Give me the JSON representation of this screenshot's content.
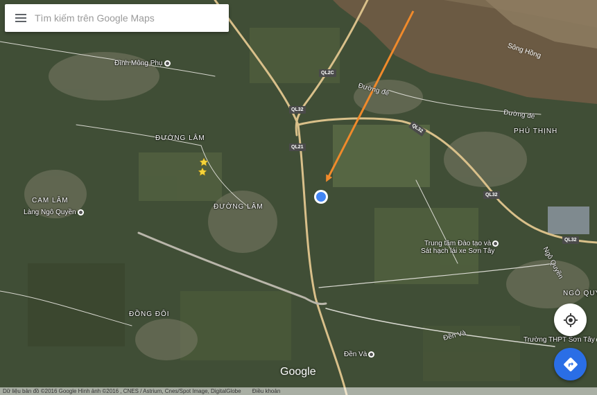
{
  "search": {
    "placeholder": "Tìm kiếm trên Google Maps"
  },
  "icons": {
    "menu": "menu-icon",
    "my_location": "my-location-icon",
    "directions": "directions-icon",
    "arrow": "orange-arrow-annotation",
    "stars": "star-icon"
  },
  "colors": {
    "accent": "#2a6ee6",
    "annotation_arrow": "#f08a2b",
    "location_dot": "#4285f4",
    "star": "#f5d33a",
    "road_major": "#d9c08a",
    "river": "#6b5a43"
  },
  "map": {
    "places": [
      {
        "id": "dinh-mong-phu",
        "text": "Đình Mông Phụ",
        "poi": true
      },
      {
        "id": "lang-ngo-quyen",
        "text": "Làng Ngô Quyền",
        "poi": true
      },
      {
        "id": "trung-tam-line1",
        "text": "Trung tâm Đào tạo và",
        "poi": true
      },
      {
        "id": "trung-tam-line2",
        "text": "Sát hạch lái xe Sơn Tây"
      },
      {
        "id": "den-va",
        "text": "Đền Và",
        "poi": true
      },
      {
        "id": "truong-thpt",
        "text": "Trường THPT Sơn Tây",
        "poi": true
      }
    ],
    "areas": [
      {
        "id": "duong-lam-1",
        "text": "ĐƯỜNG LÂM"
      },
      {
        "id": "duong-lam-2",
        "text": "ĐƯỜNG LÂM"
      },
      {
        "id": "cam-lam",
        "text": "CAM LÂM"
      },
      {
        "id": "dong-doi",
        "text": "ĐỒNG ĐÔI"
      },
      {
        "id": "phu-thinh",
        "text": "PHÚ THỊNH"
      },
      {
        "id": "ngo-quy",
        "text": "NGÔ QUY"
      }
    ],
    "roads": [
      {
        "id": "duong-de-1",
        "text": "Đường đê"
      },
      {
        "id": "duong-de-2",
        "text": "Đường đê"
      },
      {
        "id": "den-va-road",
        "text": "Đền Và"
      },
      {
        "id": "ngo-quyen-road",
        "text": "Ngô Quyền"
      }
    ],
    "river": "Sông Hồng",
    "shields": [
      {
        "id": "ql2c",
        "text": "QL2C"
      },
      {
        "id": "ql32-a",
        "text": "QL32"
      },
      {
        "id": "ql21",
        "text": "QL21"
      },
      {
        "id": "ql32-b",
        "text": "QL32"
      },
      {
        "id": "ql32-c",
        "text": "QL32"
      },
      {
        "id": "ql32-d",
        "text": "QL32"
      }
    ]
  },
  "branding": {
    "logo": "Google"
  },
  "attribution": {
    "data": "Dữ liệu bản đồ ©2016 Google Hình ảnh ©2016 , CNES / Astrium, Cnes/Spot Image, DigitalGlobe",
    "terms": "Điều khoản"
  }
}
